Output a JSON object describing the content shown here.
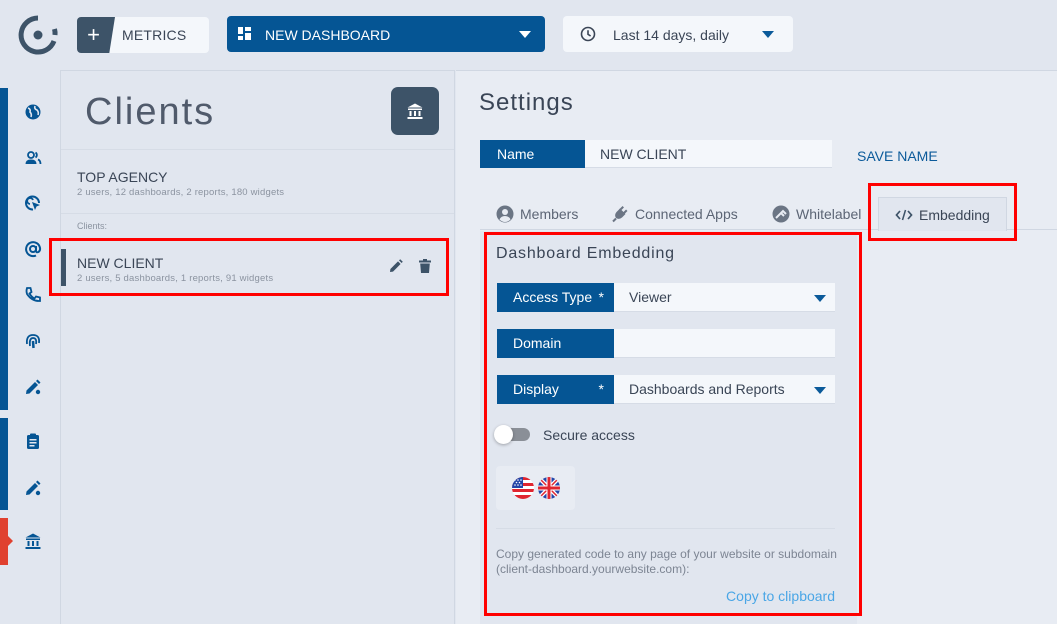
{
  "topbar": {
    "logo": "app-logo",
    "metrics_button": {
      "icon": "plus-icon",
      "label": "METRICS"
    },
    "dashboard_select": {
      "icon": "dashboard-grid-icon",
      "value": "NEW DASHBOARD"
    },
    "date_select": {
      "icon": "clock-icon",
      "value": "Last 14 days, daily"
    }
  },
  "leftnav": {
    "items": [
      {
        "icon": "globe-icon"
      },
      {
        "icon": "users-icon"
      },
      {
        "icon": "cursor-click-icon"
      },
      {
        "icon": "at-sign-icon"
      },
      {
        "icon": "phone-icon"
      },
      {
        "icon": "fingerprint-icon"
      },
      {
        "icon": "pencil-icon"
      },
      {
        "icon": "clipboard-icon"
      },
      {
        "icon": "pencil-icon"
      },
      {
        "icon": "bank-icon",
        "active": true
      }
    ],
    "colors": {
      "bar": "#055594",
      "active": "#e0412f"
    }
  },
  "clients": {
    "title": "Clients",
    "agency": {
      "name": "TOP AGENCY",
      "stats": "2 users, 12 dashboards, 2 reports, 180 widgets"
    },
    "caption": "Clients:",
    "items": [
      {
        "name": "NEW CLIENT",
        "stats": "2 users, 5 dashboards, 1 reports, 91 widgets"
      }
    ]
  },
  "settings": {
    "title": "Settings",
    "name_label": "Name",
    "name_value": "NEW CLIENT",
    "save_name": "SAVE NAME",
    "tabs": [
      {
        "label": "Members",
        "icon": "user-circle-icon"
      },
      {
        "label": "Connected Apps",
        "icon": "plug-icon"
      },
      {
        "label": "Whitelabel",
        "icon": "brush-icon"
      },
      {
        "label": "Embedding",
        "icon": "code-icon",
        "active": true
      }
    ],
    "embedding": {
      "title": "Dashboard Embedding",
      "access_type": {
        "label": "Access Type",
        "required": "*",
        "value": "Viewer"
      },
      "domain": {
        "label": "Domain",
        "value": ""
      },
      "display": {
        "label": "Display",
        "required": "*",
        "value": "Dashboards and Reports"
      },
      "secure_access": {
        "label": "Secure access",
        "enabled": false
      },
      "languages": [
        {
          "icon": "us-flag-icon"
        },
        {
          "icon": "uk-flag-icon"
        }
      ],
      "description": "Copy generated code to any page of your website or subdomain (client-dashboard.yourwebsite.com):",
      "copy_link": "Copy to clipboard"
    }
  },
  "colors": {
    "primary": "#055594",
    "dark": "#3d5368",
    "link": "#4aa6e6",
    "highlight": "#ff0000"
  }
}
